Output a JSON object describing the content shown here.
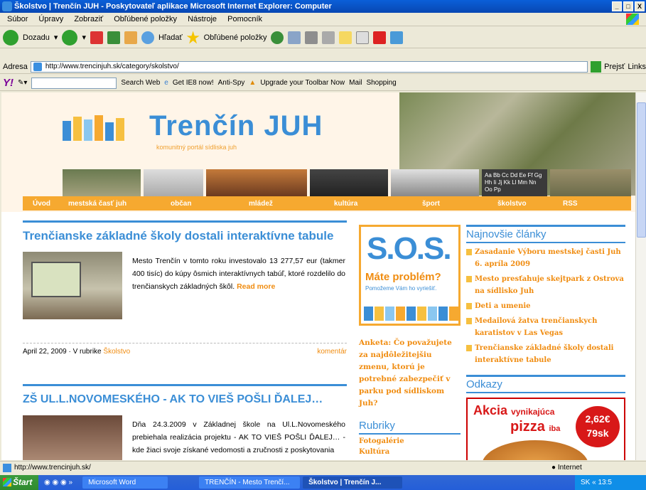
{
  "window": {
    "title": "Školstvo | Trenčín JUH    - Poskytovateľ aplikace Microsoft Internet Explorer: Computer",
    "buttons": [
      "_",
      "□",
      "X"
    ]
  },
  "menu": [
    "Súbor",
    "Úpravy",
    "Zobraziť",
    "Obľúbené položky",
    "Nástroje",
    "Pomocník"
  ],
  "toolbar": {
    "back": "Dozadu",
    "search": "Hľadať",
    "favorites": "Obľúbené položky"
  },
  "address": {
    "label": "Adresa",
    "url": "http://www.trencinjuh.sk/category/skolstvo/",
    "go": "Prejsť",
    "links": "Links"
  },
  "yahoo_toolbar": {
    "logo": "Y!",
    "search_web": "Search Web",
    "ie8": "Get IE8 now!",
    "antispy": "Anti-Spy",
    "upgrade": "Upgrade your Toolbar Now",
    "mail": "Mail",
    "shopping": "Shopping"
  },
  "site": {
    "title": "Trenčín JUH",
    "subtitle": "komunitný portál sídliska juh",
    "nav": [
      "Úvod",
      "mestská časť juh",
      "občan",
      "mládež",
      "kultúra",
      "šport",
      "školstvo",
      "RSS"
    ],
    "strip_text": "Aa Bb Cc Dd Ee Ff Gg Hh Ii Jj Kk Ll Mm Nn Oo Pp"
  },
  "articles": [
    {
      "title": "Trenčianske základné školy dostali interaktívne tabule",
      "body": "Mesto Trenčín v tomto roku investovalo 13 277,57 eur (takmer 400 tisíc) do kúpy ôsmich interaktívnych tabúľ, ktoré rozdelilo do trenčianskych základných škôl.",
      "read_more": "Read more",
      "date": "April 22, 2009 · V rubrike",
      "category": "Školstvo",
      "comment": "komentár"
    },
    {
      "title": "ZŠ UL.L.NOVOMESKÉHO - AK TO VIEŠ POŠLI ĎALEJ…",
      "body": "Dňa 24.3.2009 v Základnej škole na Ul.L.Novomeského prebiehala realizácia projektu - AK TO VIEŠ POŠLI ĎALEJ… - kde žiaci svoje získané vedomosti a zručnosti z poskytovania"
    }
  ],
  "sos": {
    "big": "S.O.S.",
    "question": "Máte problém?",
    "sub": "Pomožeme Vám ho vyriešiť."
  },
  "poll": "Anketa: Čo považujete za najdôležitejšiu zmenu, ktorú je potrebné zabezpečiť v parku pod sídliskom Juh?",
  "rubriky": {
    "title": "Rubriky",
    "items": [
      "Fotogalérie",
      "Kultúra"
    ]
  },
  "news": {
    "title": "Najnovšie články",
    "items": [
      "Zasadanie Výboru mestskej časti Juh 6. apríla 2009",
      "Mesto presťahuje skejtpark z Ostrova na sídlisko Juh",
      "Deti a umenie",
      "Medailová žatva trenčianskych karatistov v Las Vegas",
      "Trenčianske základné školy dostali interaktívne tabule"
    ]
  },
  "odkazy": {
    "title": "Odkazy",
    "pizza_line1": "Akcia",
    "pizza_line1b": "vynikajúca",
    "pizza_line2": "pizza",
    "pizza_line2b": "iba",
    "price1": "2,62€",
    "price2": "79sk"
  },
  "status": {
    "url": "http://www.trencinjuh.sk/",
    "zone": "Internet"
  },
  "taskbar": {
    "start": "Štart",
    "tasks": [
      "Microsoft Word",
      "TRENČÍN - Mesto Trenčí...",
      "Školstvo | Trenčín J..."
    ],
    "tray": "SK  « 13:5"
  },
  "colors": {
    "brand_blue": "#3b8ed6",
    "brand_orange": "#f6a930"
  }
}
